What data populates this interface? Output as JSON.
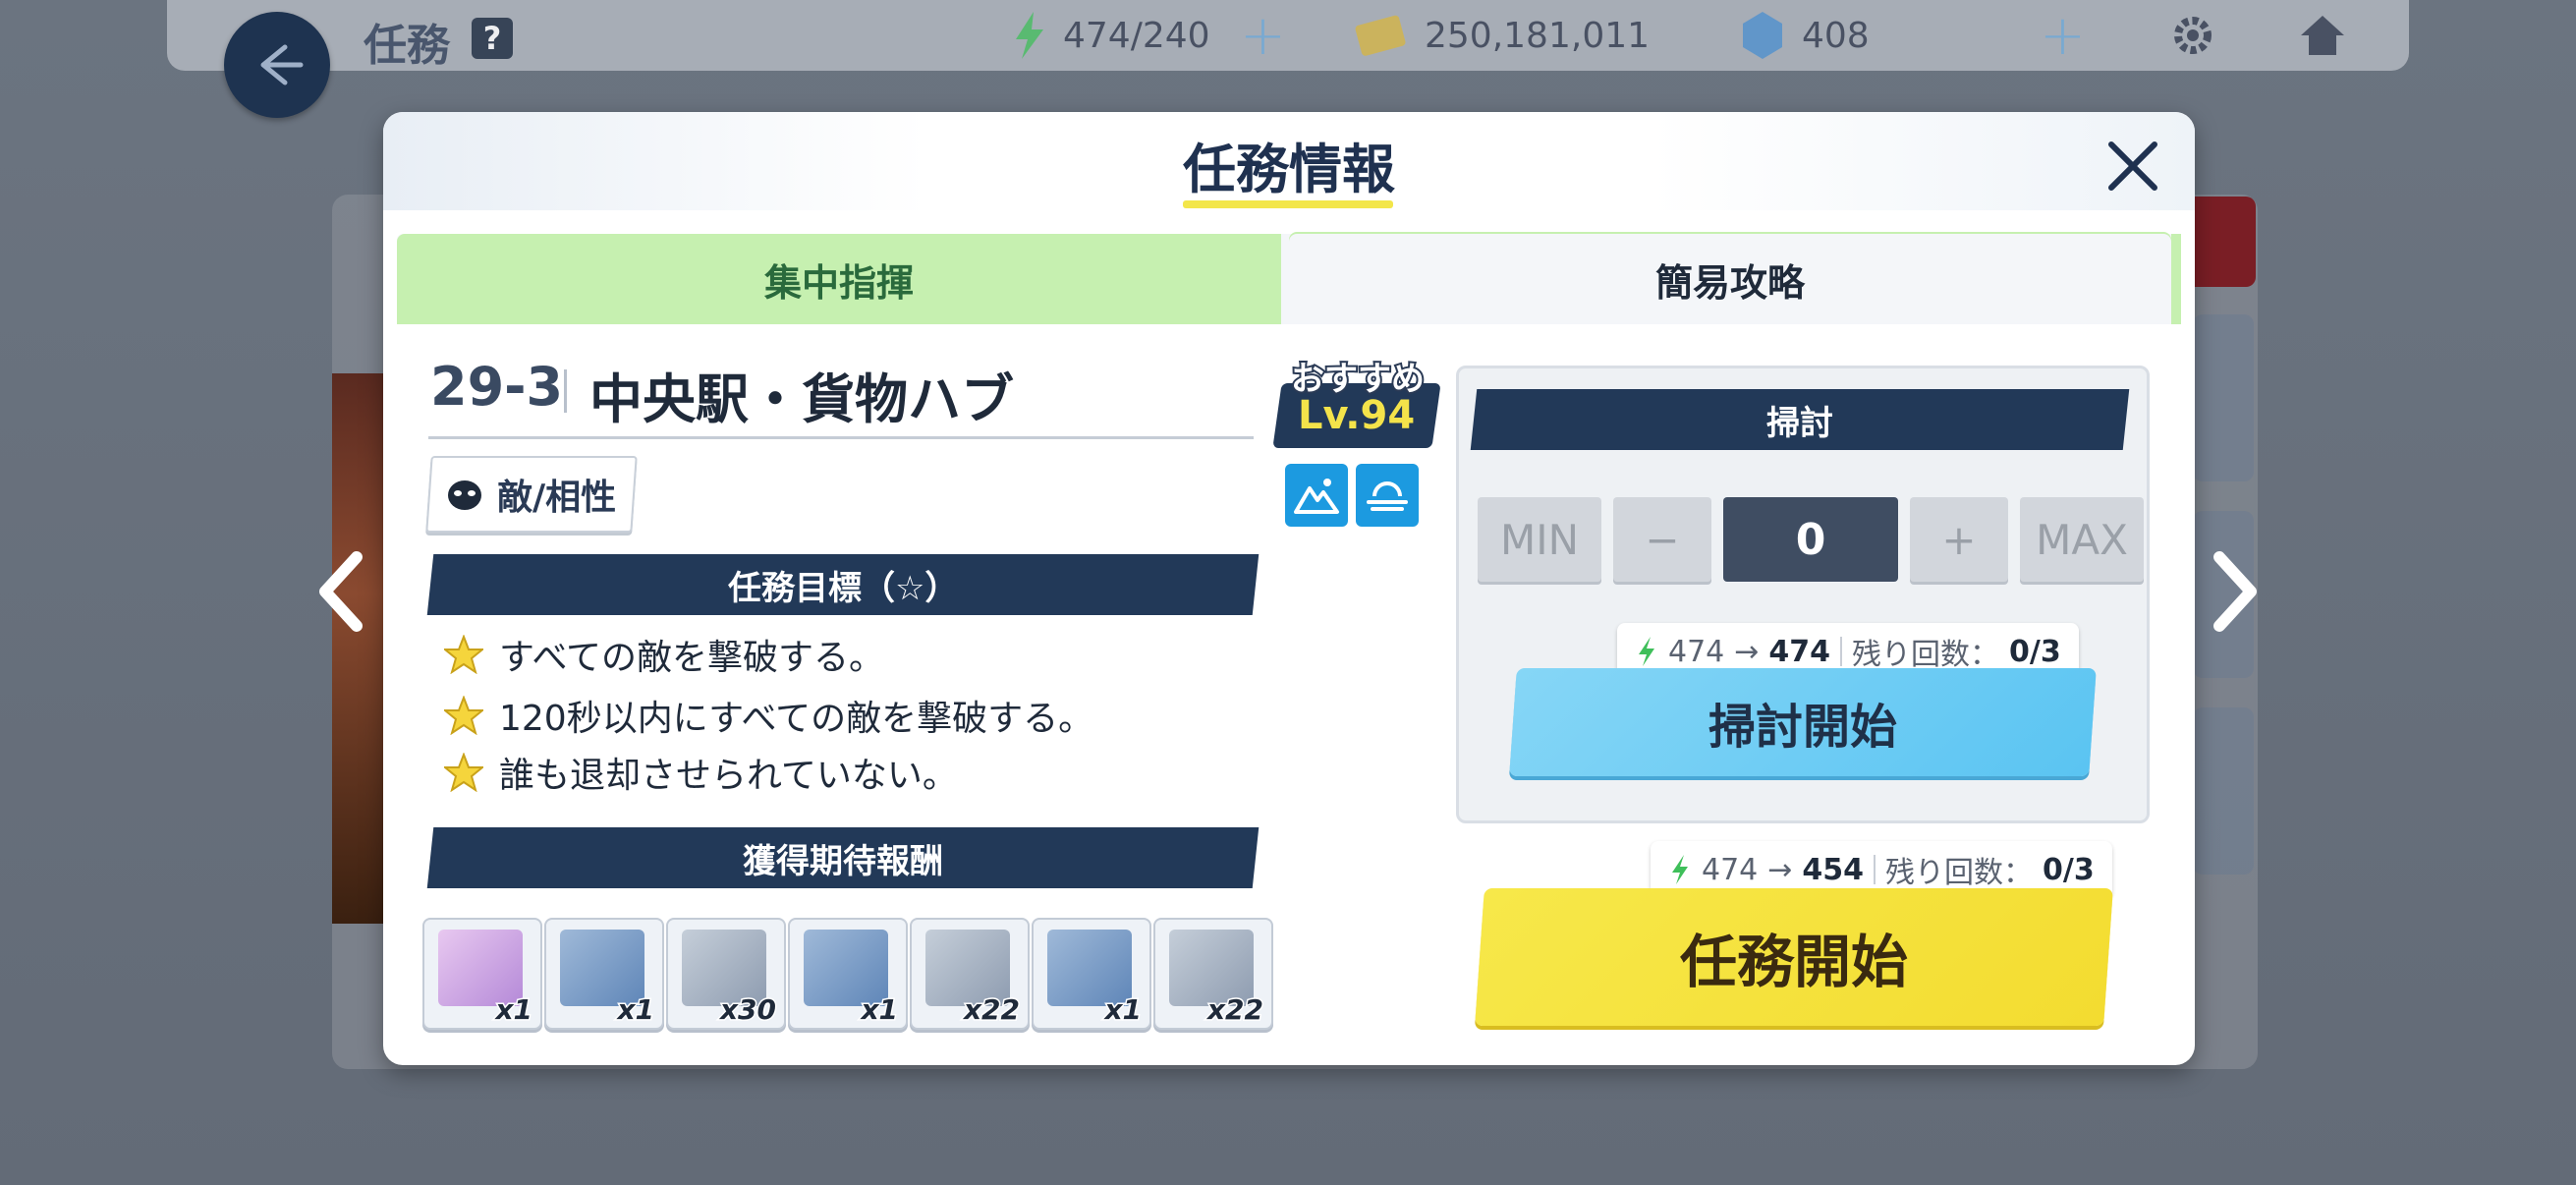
{
  "header": {
    "title": "任務",
    "help": "?",
    "ap": "474/240",
    "credits": "250,181,011",
    "gems": "408"
  },
  "modal": {
    "title": "任務情報",
    "tabs": [
      {
        "label": "集中指揮"
      },
      {
        "label": "簡易攻略"
      }
    ],
    "stage_id": "29-3",
    "stage_name": "中央駅・貨物ハブ",
    "recommend_label": "おすすめ",
    "recommend_level": "Lv.94",
    "enemy_button": "敵/相性",
    "objectives_title": "任務目標（☆）",
    "objectives": [
      "すべての敵を撃破する。",
      "120秒以内にすべての敵を撃破する。",
      "誰も退却させられていない。"
    ],
    "rewards_title": "獲得期待報酬",
    "rewards": [
      {
        "qty": "x1",
        "icon": "student-portrait-icon"
      },
      {
        "qty": "x1",
        "icon": "backpack-icon"
      },
      {
        "qty": "x30",
        "icon": "bag-icon"
      },
      {
        "qty": "x1",
        "icon": "charm-icon"
      },
      {
        "qty": "x22",
        "icon": "necklace-icon"
      },
      {
        "qty": "x1",
        "icon": "watch-icon"
      },
      {
        "qty": "x22",
        "icon": "watch-icon"
      }
    ],
    "sweep": {
      "title": "掃討",
      "min": "MIN",
      "minus": "−",
      "count": "0",
      "plus": "+",
      "max": "MAX",
      "ap_from": "474",
      "ap_to": "474",
      "remaining_label": "残り回数：",
      "remaining": "0/3",
      "start": "掃討開始"
    },
    "mission": {
      "ap_from": "474",
      "ap_to": "454",
      "remaining_label": "残り回数：",
      "remaining": "0/3",
      "start": "任務開始"
    }
  },
  "colors": {
    "navy": "#223958",
    "tab_active": "#c6f0b0",
    "sweep_button": "#5ac4f2",
    "mission_button": "#f3dc30",
    "level_text": "#f4e34a"
  }
}
